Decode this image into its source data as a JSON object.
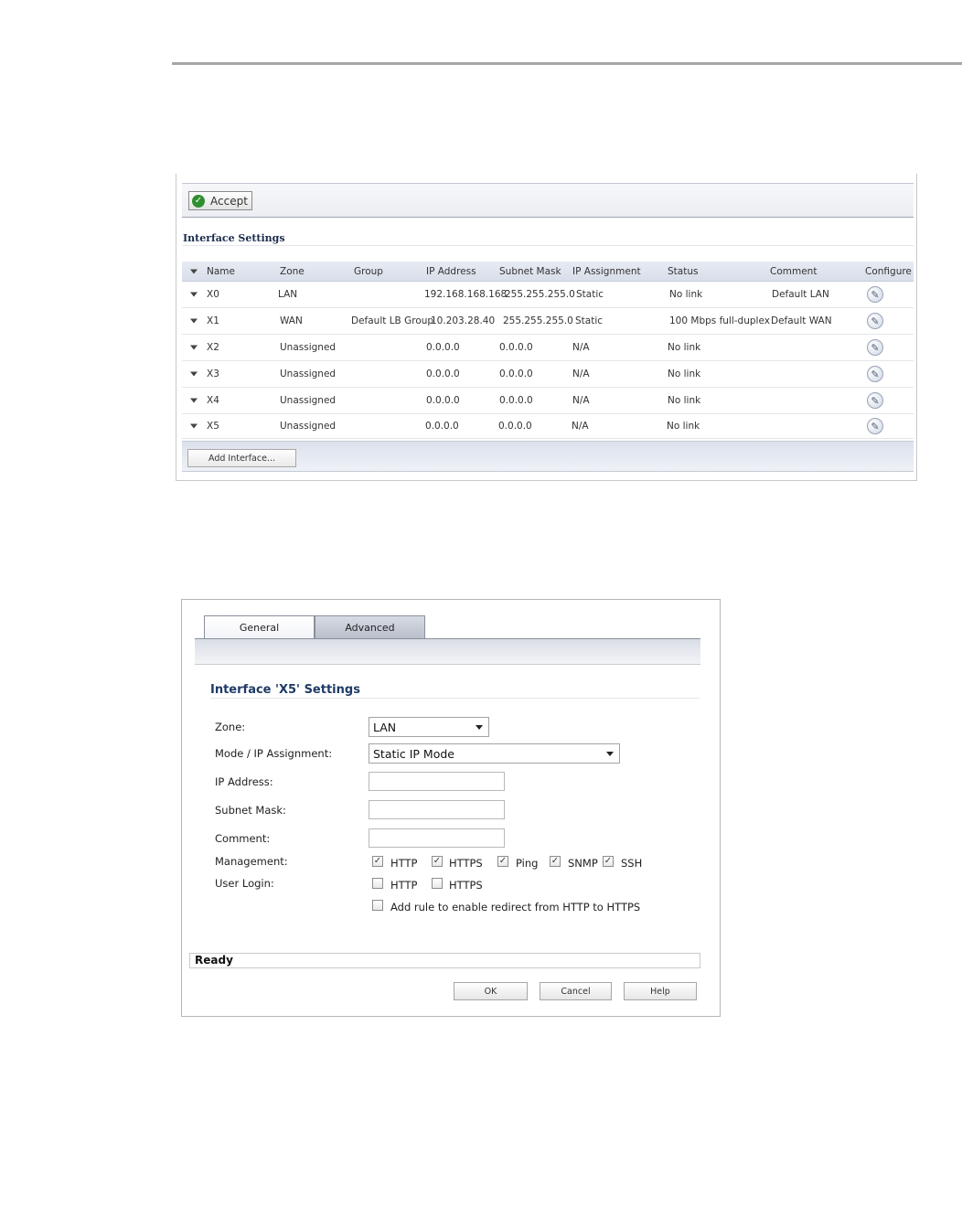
{
  "interface_settings": {
    "accept_label": "Accept",
    "title": "Interface Settings",
    "columns": [
      "Name",
      "Zone",
      "Group",
      "IP Address",
      "Subnet Mask",
      "IP Assignment",
      "Status",
      "Comment",
      "Configure"
    ],
    "rows": [
      {
        "name": "X0",
        "zone": "LAN",
        "group": "",
        "ip": "192.168.168.168",
        "mask": "255.255.255.0",
        "assign": "Static",
        "status": "No link",
        "comment": "Default LAN"
      },
      {
        "name": "X1",
        "zone": "WAN",
        "group": "Default LB Group",
        "ip": "10.203.28.40",
        "mask": "255.255.255.0",
        "assign": "Static",
        "status": "100 Mbps full-duplex",
        "comment": "Default WAN"
      },
      {
        "name": "X2",
        "zone": "Unassigned",
        "group": "",
        "ip": "0.0.0.0",
        "mask": "0.0.0.0",
        "assign": "N/A",
        "status": "No link",
        "comment": ""
      },
      {
        "name": "X3",
        "zone": "Unassigned",
        "group": "",
        "ip": "0.0.0.0",
        "mask": "0.0.0.0",
        "assign": "N/A",
        "status": "No link",
        "comment": ""
      },
      {
        "name": "X4",
        "zone": "Unassigned",
        "group": "",
        "ip": "0.0.0.0",
        "mask": "0.0.0.0",
        "assign": "N/A",
        "status": "No link",
        "comment": ""
      },
      {
        "name": "X5",
        "zone": "Unassigned",
        "group": "",
        "ip": "0.0.0.0",
        "mask": "0.0.0.0",
        "assign": "N/A",
        "status": "No link",
        "comment": ""
      }
    ],
    "add_interface_label": "Add Interface..."
  },
  "dialog": {
    "tabs": [
      "General",
      "Advanced"
    ],
    "title": "Interface 'X5' Settings",
    "zone_label": "Zone:",
    "zone_value": "LAN",
    "mode_label": "Mode / IP Assignment:",
    "mode_value": "Static IP Mode",
    "ip_label": "IP Address:",
    "ip_value": "",
    "mask_label": "Subnet Mask:",
    "mask_value": "",
    "comment_label": "Comment:",
    "comment_value": "",
    "management_label": "Management:",
    "management": [
      {
        "label": "HTTP",
        "checked": true
      },
      {
        "label": "HTTPS",
        "checked": true
      },
      {
        "label": "Ping",
        "checked": true
      },
      {
        "label": "SNMP",
        "checked": true
      },
      {
        "label": "SSH",
        "checked": true
      }
    ],
    "user_login_label": "User Login:",
    "user_login": [
      {
        "label": "HTTP",
        "checked": false
      },
      {
        "label": "HTTPS",
        "checked": false
      }
    ],
    "redirect_label": "Add rule to enable redirect from HTTP to HTTPS",
    "redirect_checked": false,
    "status": "Ready",
    "ok_label": "OK",
    "cancel_label": "Cancel",
    "help_label": "Help"
  }
}
